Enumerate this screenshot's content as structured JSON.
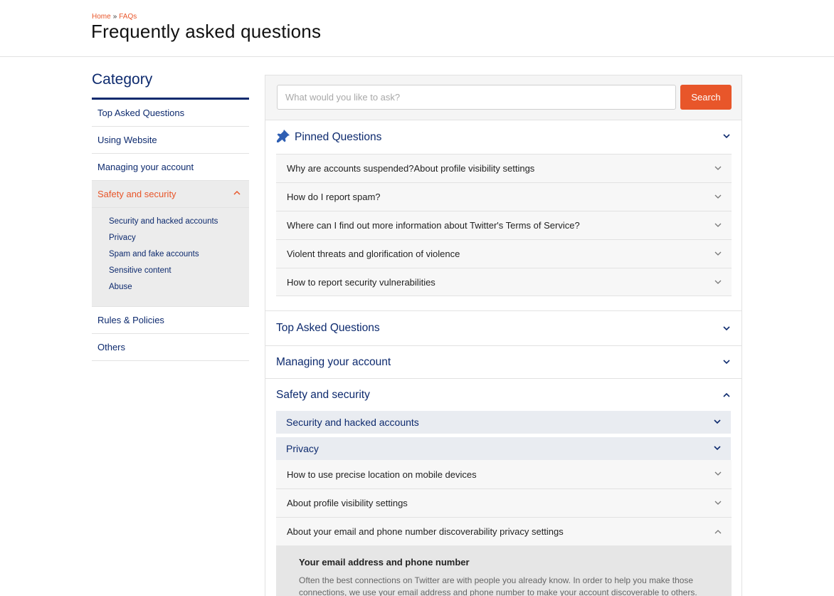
{
  "header": {
    "breadcrumb": {
      "home": "Home",
      "separator": "»",
      "current": "FAQs"
    },
    "title": "Frequently asked questions"
  },
  "sidebar": {
    "title": "Category",
    "items": [
      {
        "label": "Top Asked Questions"
      },
      {
        "label": "Using Website"
      },
      {
        "label": "Managing your account"
      },
      {
        "label": "Safety and security",
        "active": true
      },
      {
        "label": "Rules & Policies"
      },
      {
        "label": "Others"
      }
    ],
    "subitems": [
      "Security and hacked accounts",
      "Privacy",
      "Spam and fake accounts",
      "Sensitive content",
      "Abuse"
    ]
  },
  "search": {
    "placeholder": "What would you like to ask?",
    "button": "Search"
  },
  "pinned": {
    "title": "Pinned Questions",
    "questions": [
      "Why are accounts suspended?About profile visibility settings",
      "How do I report spam?",
      "Where can I find out more information about Twitter's Terms of Service?",
      "Violent threats and glorification of violence",
      "How to report security vulnerabilities"
    ]
  },
  "sections": {
    "top_asked": "Top Asked Questions",
    "managing": "Managing your account",
    "safety": "Safety and security"
  },
  "safety": {
    "subsections": [
      "Security and hacked accounts",
      "Privacy"
    ],
    "privacy_questions": [
      "How to use precise location on mobile devices",
      "About profile visibility settings",
      "About your email and phone number discoverability privacy settings"
    ],
    "answer": {
      "heading": "Your email address and phone number",
      "text": "Often the best connections on Twitter are with people you already know. In order to help you make those connections, we use your email address and phone number to make your account discoverable to others."
    }
  },
  "colors": {
    "accent": "#e8562a",
    "navy": "#0d2a6e",
    "icon_blue": "#2f5fb3"
  }
}
